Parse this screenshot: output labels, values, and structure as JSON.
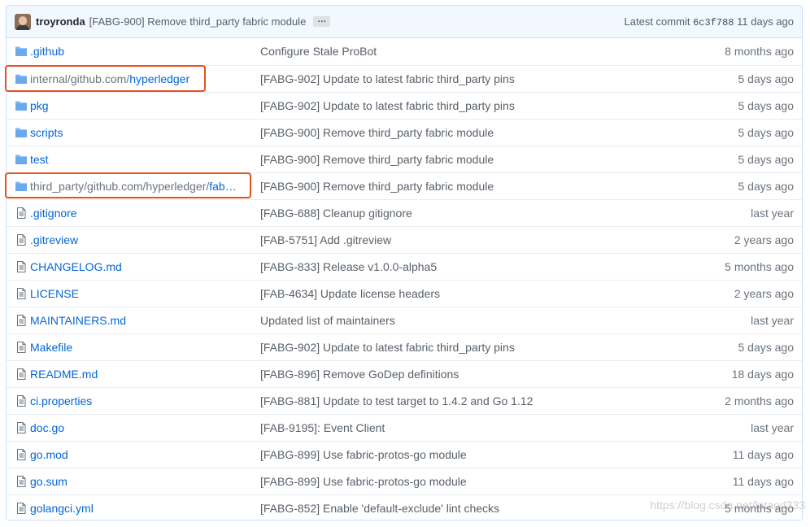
{
  "commit": {
    "author": "troyronda",
    "message": "[FABG-900] Remove third_party fabric module",
    "more": "…",
    "latest_label": "Latest commit",
    "sha": "6c3f788",
    "age": "11 days ago"
  },
  "colors": {
    "link": "#0366d6",
    "folder": "#79b8ff",
    "highlight": "#e8501e",
    "header_bg": "#f1f8ff"
  },
  "files": [
    {
      "type": "dir",
      "icon": "folder-icon",
      "name": ".github",
      "message": "Configure Stale ProBot",
      "age": "8 months ago"
    },
    {
      "type": "dir",
      "icon": "folder-icon",
      "prefix": "internal/github.com/",
      "name": "hyperledger",
      "message": "[FABG-902] Update to latest fabric third_party pins",
      "age": "5 days ago"
    },
    {
      "type": "dir",
      "icon": "folder-icon",
      "name": "pkg",
      "message": "[FABG-902] Update to latest fabric third_party pins",
      "age": "5 days ago"
    },
    {
      "type": "dir",
      "icon": "folder-icon",
      "name": "scripts",
      "message": "[FABG-900] Remove third_party fabric module",
      "age": "5 days ago"
    },
    {
      "type": "dir",
      "icon": "folder-icon",
      "name": "test",
      "message": "[FABG-900] Remove third_party fabric module",
      "age": "5 days ago"
    },
    {
      "type": "dir",
      "icon": "folder-icon",
      "prefix": "third_party/github.com/hyperledger/",
      "name": "fab…",
      "message": "[FABG-900] Remove third_party fabric module",
      "age": "5 days ago"
    },
    {
      "type": "file",
      "icon": "file-icon",
      "name": ".gitignore",
      "message": "[FABG-688] Cleanup gitignore",
      "age": "last year"
    },
    {
      "type": "file",
      "icon": "file-icon",
      "name": ".gitreview",
      "message": "[FAB-5751] Add .gitreview",
      "age": "2 years ago"
    },
    {
      "type": "file",
      "icon": "file-icon",
      "name": "CHANGELOG.md",
      "message": "[FABG-833] Release v1.0.0-alpha5",
      "age": "5 months ago"
    },
    {
      "type": "file",
      "icon": "file-icon",
      "name": "LICENSE",
      "message": "[FAB-4634] Update license headers",
      "age": "2 years ago"
    },
    {
      "type": "file",
      "icon": "file-icon",
      "name": "MAINTAINERS.md",
      "message": "Updated list of maintainers",
      "age": "last year"
    },
    {
      "type": "file",
      "icon": "file-icon",
      "name": "Makefile",
      "message": "[FABG-902] Update to latest fabric third_party pins",
      "age": "5 days ago"
    },
    {
      "type": "file",
      "icon": "file-icon",
      "name": "README.md",
      "message": "[FABG-896] Remove GoDep definitions",
      "age": "18 days ago"
    },
    {
      "type": "file",
      "icon": "file-icon",
      "name": "ci.properties",
      "message": "[FABG-881] Update to test target to 1.4.2 and Go 1.12",
      "age": "2 months ago"
    },
    {
      "type": "file",
      "icon": "file-icon",
      "name": "doc.go",
      "message": "[FAB-9195]: Event Client",
      "age": "last year"
    },
    {
      "type": "file",
      "icon": "file-icon",
      "name": "go.mod",
      "message": "[FABG-899] Use fabric-protos-go module",
      "age": "11 days ago"
    },
    {
      "type": "file",
      "icon": "file-icon",
      "name": "go.sum",
      "message": "[FABG-899] Use fabric-protos-go module",
      "age": "11 days ago"
    },
    {
      "type": "file",
      "icon": "file-icon",
      "name": "golangci.yml",
      "message": "[FABG-852] Enable 'default-exclude' lint checks",
      "age": "5 months ago"
    }
  ],
  "watermark": "https://blog.csdn.net/lataod333"
}
